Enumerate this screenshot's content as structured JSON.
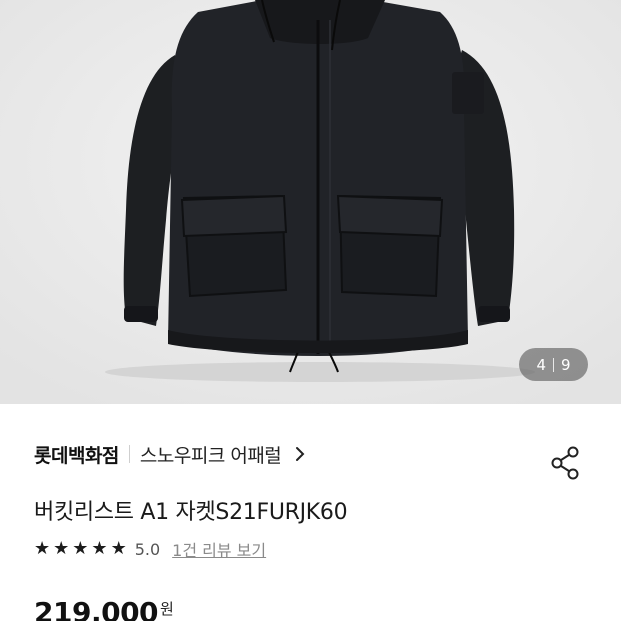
{
  "gallery": {
    "current": "4",
    "total": "9",
    "image_icon": "product-jacket-image"
  },
  "store": {
    "name": "롯데백화점",
    "brand": "스노우피크 어패럴"
  },
  "product": {
    "title": "버킷리스트 A1 자켓S21FURJK60",
    "rating": "5.0",
    "review_link": "1건 리뷰 보기",
    "price": "219,000",
    "currency": "원"
  },
  "icons": {
    "star": "star-icon",
    "share": "share-icon",
    "chevron": "chevron-right-icon"
  }
}
